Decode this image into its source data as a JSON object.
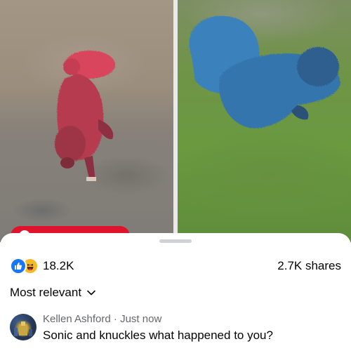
{
  "post": {
    "reaction_count": "18.2K",
    "shares": "2.7K shares",
    "reaction_icons": [
      "like-icon",
      "haha-icon"
    ]
  },
  "comments": {
    "sort_label": "Most relevant",
    "items": [
      {
        "author": "Kellen Ashford",
        "separator": " · ",
        "time": "Just now",
        "text": "Sonic and knuckles what happened to you?"
      }
    ]
  },
  "colors": {
    "like_blue": "#1877f2",
    "haha_yellow": "#f7b928",
    "tag_red": "#e0132d",
    "text_primary": "#050505",
    "text_secondary": "#65676b"
  }
}
